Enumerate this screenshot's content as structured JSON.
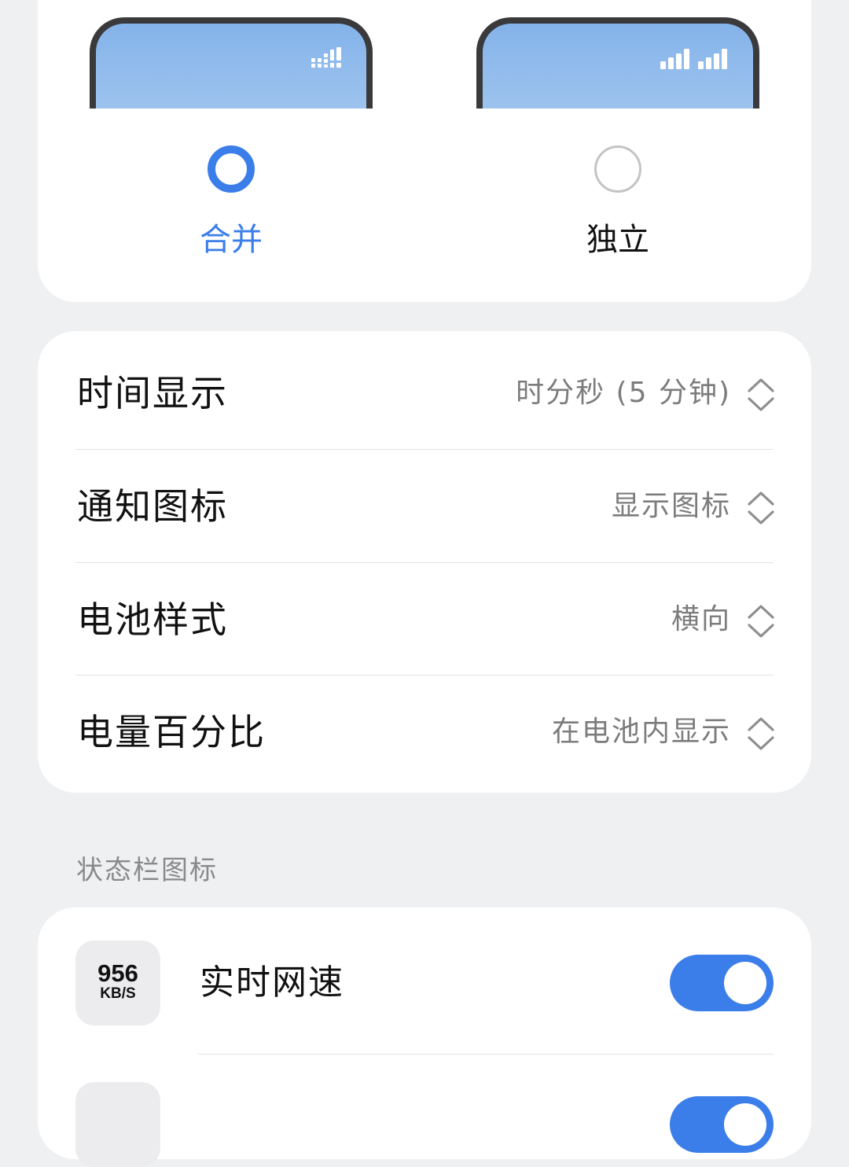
{
  "signal_style": {
    "options": [
      {
        "label": "合并",
        "selected": true
      },
      {
        "label": "独立",
        "selected": false
      }
    ]
  },
  "settings": {
    "items": [
      {
        "label": "时间显示",
        "value": "时分秒 (5 分钟)"
      },
      {
        "label": "通知图标",
        "value": "显示图标"
      },
      {
        "label": "电池样式",
        "value": "横向"
      },
      {
        "label": "电量百分比",
        "value": "在电池内显示"
      }
    ]
  },
  "status_bar_icons": {
    "header": "状态栏图标",
    "items": [
      {
        "label": "实时网速",
        "icon_value": "956",
        "icon_unit": "KB/S",
        "enabled": true
      },
      {
        "enabled": true
      }
    ]
  },
  "colors": {
    "accent": "#3b7ee9",
    "page_background": "#eff0f2",
    "card_background": "#ffffff",
    "secondary_text": "#7c7c7e"
  }
}
